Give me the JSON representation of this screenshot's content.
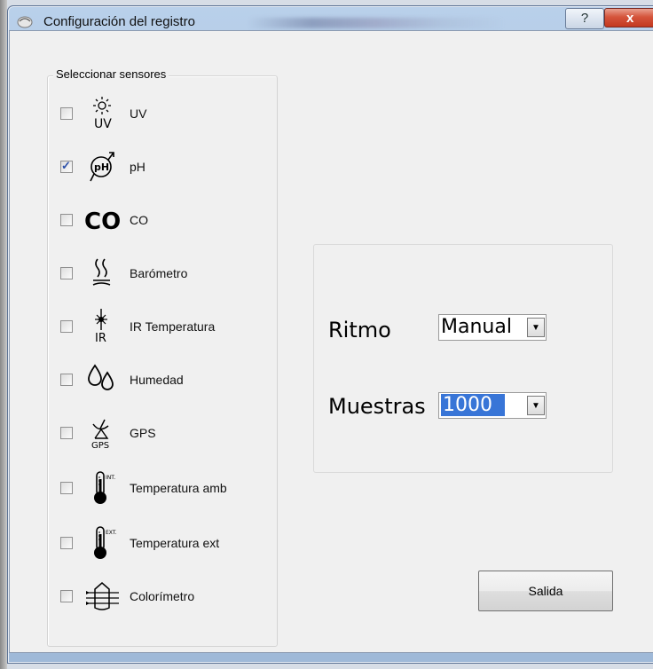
{
  "window": {
    "title": "Configuración del registro",
    "help_label": "?",
    "close_label": "x"
  },
  "sensors": {
    "group_title": "Seleccionar sensores",
    "items": [
      {
        "label": "UV",
        "checked": false,
        "icon": "sun-uv-icon",
        "icon_text": "UV"
      },
      {
        "label": "pH",
        "checked": true,
        "icon": "ph-probe-icon",
        "icon_text": "pH"
      },
      {
        "label": "CO",
        "checked": false,
        "icon": "co-gas-icon",
        "icon_text": "CO"
      },
      {
        "label": "Barómetro",
        "checked": false,
        "icon": "barometer-icon",
        "icon_text": ""
      },
      {
        "label": "IR Temperatura",
        "checked": false,
        "icon": "ir-temperature-icon",
        "icon_text": "IR"
      },
      {
        "label": "Humedad",
        "checked": false,
        "icon": "humidity-drops-icon",
        "icon_text": ""
      },
      {
        "label": "GPS",
        "checked": false,
        "icon": "satellite-gps-icon",
        "icon_text": "GPS"
      },
      {
        "label": "Temperatura amb",
        "checked": false,
        "icon": "thermometer-int-icon",
        "icon_text": "INT."
      },
      {
        "label": "Temperatura ext",
        "checked": false,
        "icon": "thermometer-ext-icon",
        "icon_text": "EXT."
      },
      {
        "label": "Colorímetro",
        "checked": false,
        "icon": "colorimeter-icon",
        "icon_text": ""
      }
    ]
  },
  "settings": {
    "rate_label": "Ritmo",
    "rate_value": "Manual",
    "samples_label": "Muestras",
    "samples_value": "1000"
  },
  "actions": {
    "exit_label": "Salida"
  },
  "colors": {
    "selection": "#3875d7",
    "close_button": "#c3381f",
    "title_bar": "#a8c2e0"
  }
}
